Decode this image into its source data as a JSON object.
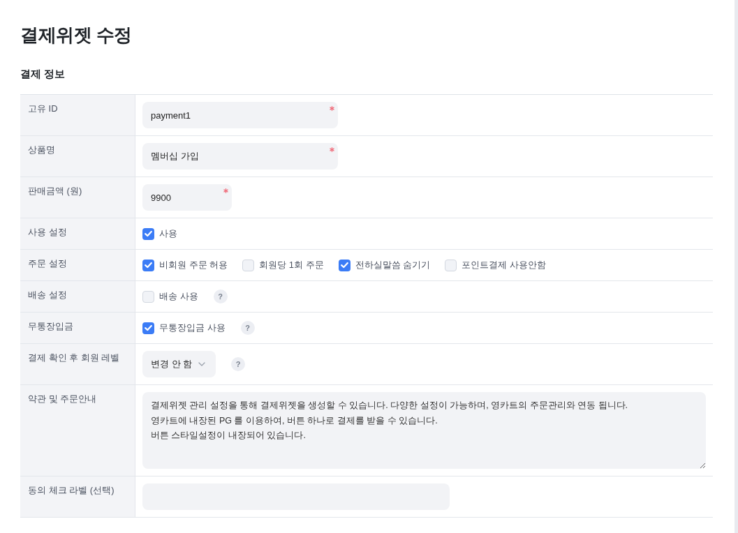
{
  "page": {
    "title": "결제위젯 수정"
  },
  "section": {
    "title": "결제 정보"
  },
  "rows": [
    {
      "label": "고유 ID",
      "kind": "text",
      "value": "payment1",
      "required": true
    },
    {
      "label": "상품명",
      "kind": "text",
      "value": "멤버십 가입",
      "required": true
    },
    {
      "label": "판매금액 (원)",
      "kind": "number",
      "value": "9900",
      "required": true
    },
    {
      "label": "사용 설정",
      "kind": "checks",
      "options": [
        {
          "label": "사용",
          "checked": true
        }
      ]
    },
    {
      "label": "주문 설정",
      "kind": "checks",
      "options": [
        {
          "label": "비회원 주문 허용",
          "checked": true
        },
        {
          "label": "회원당 1회 주문",
          "checked": false
        },
        {
          "label": "전하실말씀 숨기기",
          "checked": true
        },
        {
          "label": "포인트결제 사용안함",
          "checked": false
        }
      ]
    },
    {
      "label": "배송 설정",
      "kind": "checks",
      "options": [
        {
          "label": "배송 사용",
          "checked": false
        }
      ],
      "help": "?"
    },
    {
      "label": "무통장입금",
      "kind": "checks",
      "options": [
        {
          "label": "무통장입금 사용",
          "checked": true
        }
      ],
      "help": "?"
    },
    {
      "label": "결제 확인 후 회원 레벨",
      "kind": "select",
      "value": "변경 안 함",
      "help": "?"
    },
    {
      "label": "약관 및 주문안내",
      "kind": "textarea",
      "value": "결제위젯 관리 설정을 통해 결제위젯을 생성할 수 있습니다. 다양한 설정이 가능하며, 영카트의 주문관리와 연동 됩니다.\n영카트에 내장된 PG 를 이용하여, 버튼 하나로 결제를 받을 수 있습니다.\n버튼 스타일설정이 내장되어 있습니다."
    },
    {
      "label": "동의 체크 라벨 (선택)",
      "kind": "wide",
      "required": false
    }
  ]
}
